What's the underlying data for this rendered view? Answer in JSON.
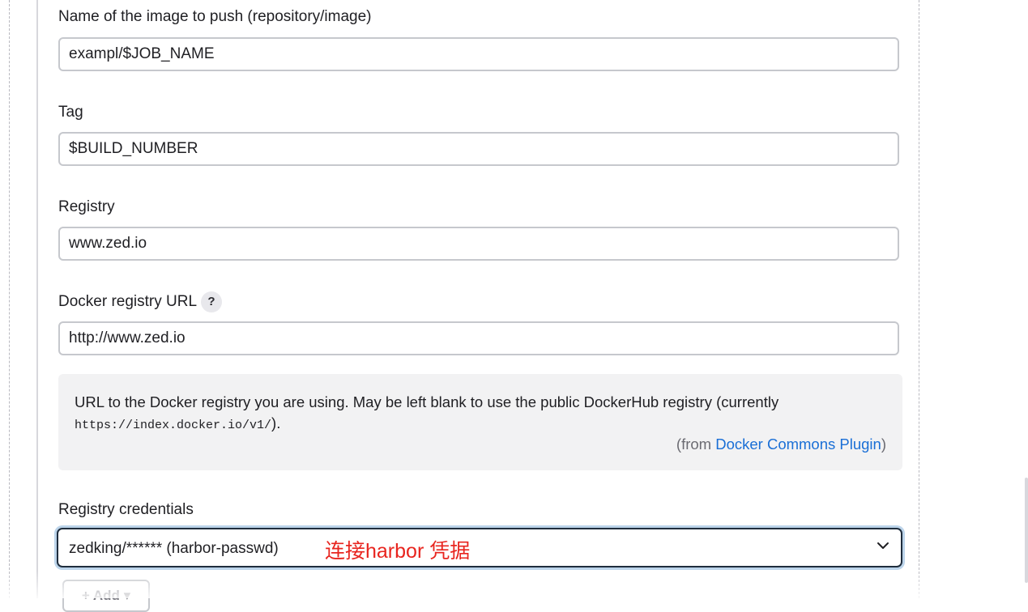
{
  "fields": {
    "image_name": {
      "label": "Name of the image to push (repository/image)",
      "value": "exampl/$JOB_NAME"
    },
    "tag": {
      "label": "Tag",
      "value": "$BUILD_NUMBER"
    },
    "registry": {
      "label": "Registry",
      "value": "www.zed.io"
    },
    "docker_registry_url": {
      "label": "Docker registry URL",
      "help_icon": "?",
      "value": "http://www.zed.io"
    },
    "registry_credentials": {
      "label": "Registry credentials",
      "selected": "zedking/****** (harbor-passwd)",
      "annotation": "连接harbor 凭据",
      "icon": "chevron-down-icon"
    }
  },
  "help": {
    "text_before": "URL to the Docker registry you are using. May be left blank to use the public DockerHub registry (currently ",
    "code": "https://index.docker.io/v1/",
    "text_after": ").",
    "from_prefix": "(from ",
    "from_link": "Docker Commons Plugin",
    "from_suffix": ")"
  },
  "buttons": {
    "add_label": "+ Add ▾"
  },
  "colors": {
    "link": "#1a6fd6",
    "annotation": "#e8251f",
    "focus_ring": "#bcd4ea"
  }
}
